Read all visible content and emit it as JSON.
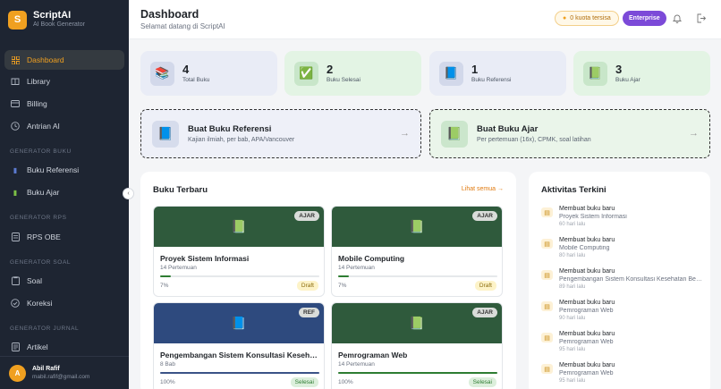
{
  "app": {
    "name": "ScriptAI",
    "subtitle": "AI Book Generator",
    "logo_letter": "S"
  },
  "sidebar": {
    "items": [
      {
        "label": "Dashboard",
        "icon": "grid-icon",
        "active": true
      },
      {
        "label": "Library",
        "icon": "book-icon"
      },
      {
        "label": "Billing",
        "icon": "card-icon"
      },
      {
        "label": "Antrian AI",
        "icon": "clock-icon"
      }
    ],
    "sections": [
      {
        "title": "GENERATOR BUKU",
        "items": [
          {
            "label": "Buku Referensi",
            "icon": "blue-book-icon"
          },
          {
            "label": "Buku Ajar",
            "icon": "green-book-icon"
          }
        ]
      },
      {
        "title": "GENERATOR RPS",
        "items": [
          {
            "label": "RPS OBE",
            "icon": "document-icon"
          }
        ]
      },
      {
        "title": "GENERATOR SOAL",
        "items": [
          {
            "label": "Soal",
            "icon": "clipboard-icon"
          },
          {
            "label": "Koreksi",
            "icon": "check-circle-icon"
          }
        ]
      },
      {
        "title": "GENERATOR JURNAL",
        "items": [
          {
            "label": "Artikel",
            "icon": "article-icon"
          }
        ]
      }
    ],
    "user": {
      "initial": "A",
      "name": "Abil Rafif",
      "email": "mabil.rafif@gmail.com"
    }
  },
  "header": {
    "title": "Dashboard",
    "subtitle": "Selamat datang di ScriptAI",
    "quota": "0 kuota tersisa",
    "plan": "Enterprise"
  },
  "stats": [
    {
      "value": "4",
      "label": "Total Buku",
      "icon": "books-icon"
    },
    {
      "value": "2",
      "label": "Buku Selesai",
      "icon": "checkmark-icon"
    },
    {
      "value": "1",
      "label": "Buku Referensi",
      "icon": "blue-book-icon"
    },
    {
      "value": "3",
      "label": "Buku Ajar",
      "icon": "green-book-icon"
    }
  ],
  "actions": [
    {
      "title": "Buat Buku Referensi",
      "desc": "Kajian ilmiah, per bab, APA/Vancouver"
    },
    {
      "title": "Buat Buku Ajar",
      "desc": "Per pertemuan (16x), CPMK, soal latihan"
    }
  ],
  "recent": {
    "title": "Buku Terbaru",
    "see_all": "Lihat semua →",
    "books": [
      {
        "tag": "AJAR",
        "title": "Proyek Sistem Informasi",
        "meta": "14 Pertemuan",
        "progress": 0.07,
        "percent": "7%",
        "status": "Draft"
      },
      {
        "tag": "AJAR",
        "title": "Mobile Computing",
        "meta": "14 Pertemuan",
        "progress": 0.07,
        "percent": "7%",
        "status": "Draft"
      },
      {
        "tag": "REF",
        "title": "Pengembangan Sistem Konsultasi Kesehatan...",
        "meta": "8 Bab",
        "progress": 1.0,
        "percent": "100%",
        "status": "Selesai"
      },
      {
        "tag": "AJAR",
        "title": "Pemrograman Web",
        "meta": "14 Pertemuan",
        "progress": 1.0,
        "percent": "100%",
        "status": "Selesai"
      }
    ]
  },
  "activity": {
    "title": "Aktivitas Terkini",
    "items": [
      {
        "action": "Membuat buku baru",
        "subject": "Proyek Sistem Informasi",
        "time": "60 hari lalu"
      },
      {
        "action": "Membuat buku baru",
        "subject": "Mobile Computing",
        "time": "80 hari lalu"
      },
      {
        "action": "Membuat buku baru",
        "subject": "Pengembangan Sistem Konsultasi Kesehatan Berb...",
        "time": "89 hari lalu"
      },
      {
        "action": "Membuat buku baru",
        "subject": "Pemrograman Web",
        "time": "90 hari lalu"
      },
      {
        "action": "Membuat buku baru",
        "subject": "Pemrograman Web",
        "time": "95 hari lalu"
      },
      {
        "action": "Membuat buku baru",
        "subject": "Pemrograman Web",
        "time": "95 hari lalu"
      }
    ]
  },
  "colors": {
    "accent": "#f0a020",
    "sidebar": "#1e2532",
    "plan": "#7c4ad8",
    "green": "#2e7d32"
  }
}
